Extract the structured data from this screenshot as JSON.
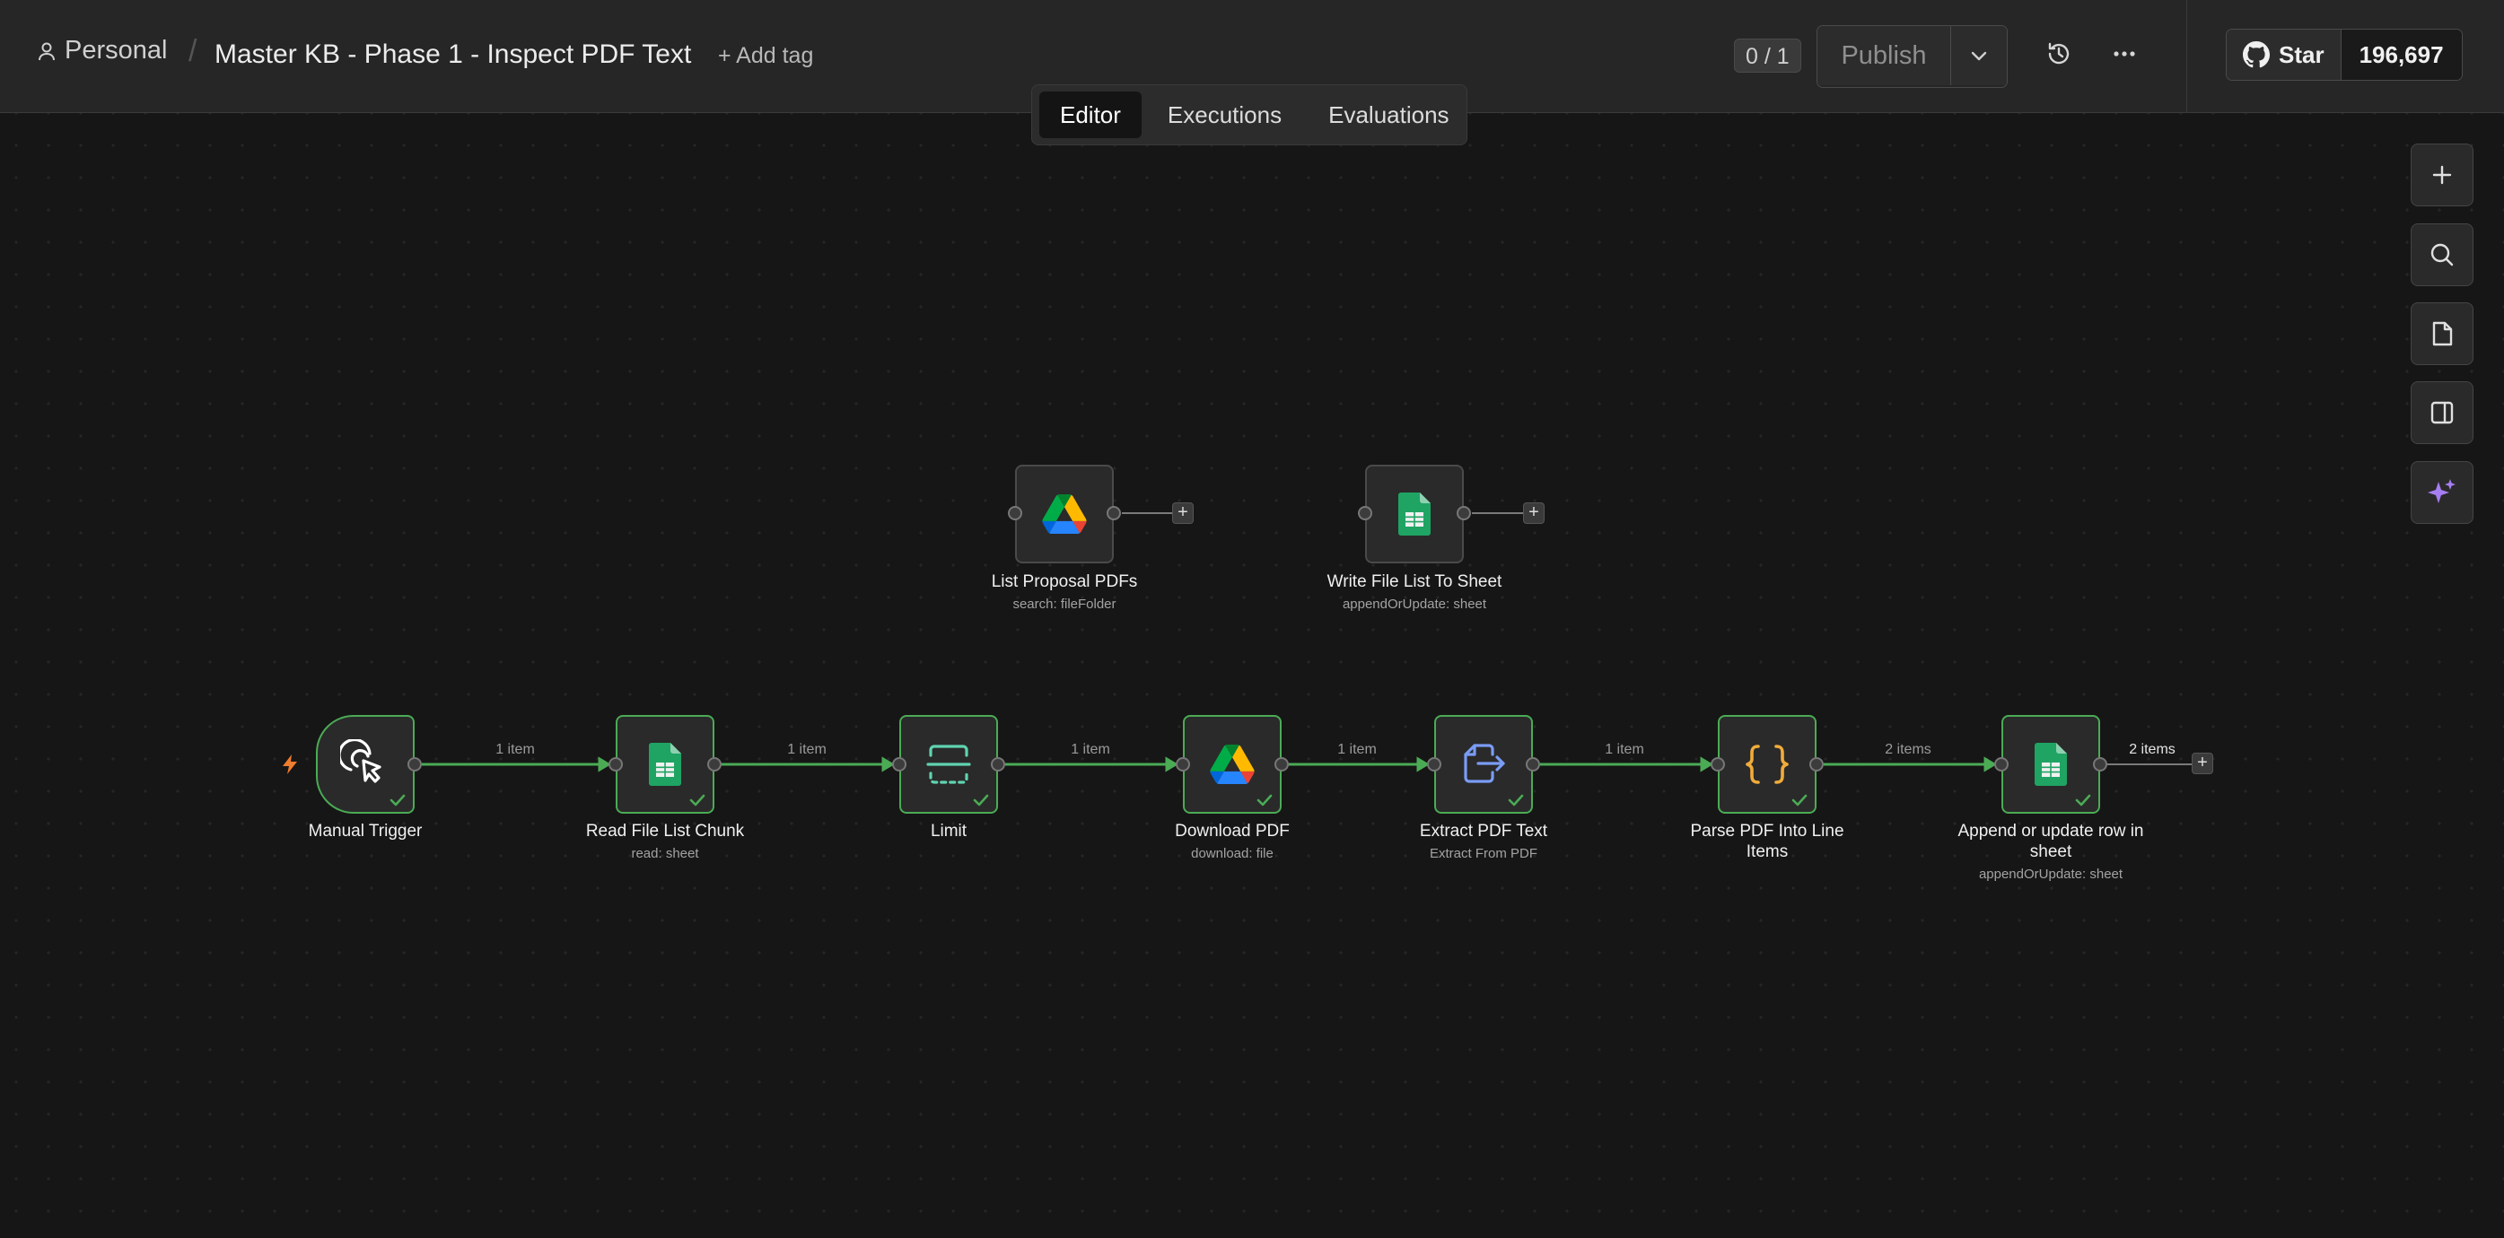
{
  "header": {
    "project": "Personal",
    "separator": "/",
    "workflow_title": "Master KB - Phase 1 - Inspect PDF Text",
    "add_tag": "+ Add tag",
    "counter": "0 / 1",
    "publish_label": "Publish",
    "star_label": "Star",
    "star_count": "196,697"
  },
  "tabs": [
    {
      "label": "Editor",
      "active": true
    },
    {
      "label": "Executions",
      "active": false
    },
    {
      "label": "Evaluations",
      "active": false
    }
  ],
  "side_toolbar": [
    "plus-icon",
    "search-icon",
    "sticky-note-icon",
    "panel-toggle-icon",
    "sparkle-ai-icon"
  ],
  "edge_labels": [
    "1 item",
    "1 item",
    "1 item",
    "1 item",
    "1 item",
    "2 items",
    "2 items"
  ],
  "nodes": {
    "list_proposal": {
      "title": "List Proposal PDFs",
      "subtitle": "search: fileFolder",
      "icon": "google-drive-icon"
    },
    "write_file_list": {
      "title": "Write File List To Sheet",
      "subtitle": "appendOrUpdate: sheet",
      "icon": "google-sheets-icon"
    },
    "manual_trigger": {
      "title": "Manual Trigger",
      "icon": "cursor-click-icon"
    },
    "read_file_list": {
      "title": "Read File List Chunk",
      "subtitle": "read: sheet",
      "icon": "google-sheets-icon"
    },
    "limit": {
      "title": "Limit",
      "icon": "limit-icon"
    },
    "download_pdf": {
      "title": "Download PDF",
      "subtitle": "download: file",
      "icon": "google-drive-icon"
    },
    "extract_pdf": {
      "title": "Extract PDF Text",
      "subtitle": "Extract From PDF",
      "icon": "extract-file-icon"
    },
    "parse_pdf": {
      "title_line1": "Parse PDF Into Line",
      "title_line2": "Items",
      "icon": "code-braces-icon"
    },
    "append_row": {
      "title_line1": "Append or update row in",
      "title_line2": "sheet",
      "subtitle": "appendOrUpdate: sheet",
      "icon": "google-sheets-icon"
    }
  },
  "colors": {
    "canvas": "#161616",
    "header": "#262626",
    "success_green": "#4bab55",
    "trigger_bolt": "#ef7c2f",
    "ai_purple": "#a77ef2",
    "limit_teal": "#5fd3b0",
    "extract_blue": "#7a9cf5",
    "code_orange": "#f0ac3a"
  }
}
